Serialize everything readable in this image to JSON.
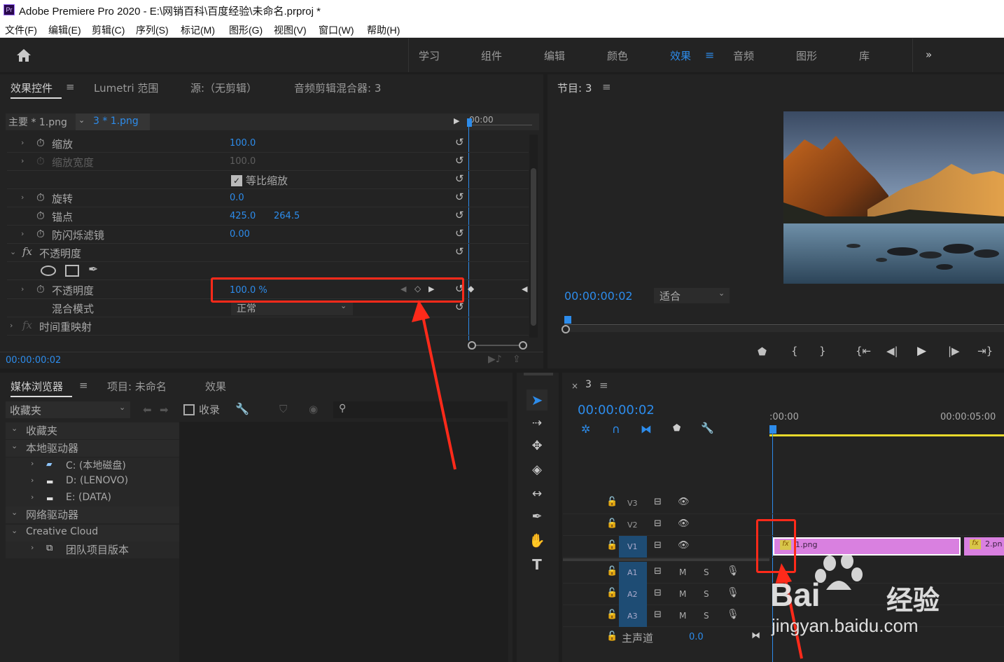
{
  "app": {
    "logo": "Pr",
    "title": "Adobe Premiere Pro 2020 - E:\\网销百科\\百度经验\\未命名.prproj *"
  },
  "menu": [
    "文件(F)",
    "编辑(E)",
    "剪辑(C)",
    "序列(S)",
    "标记(M)",
    "图形(G)",
    "视图(V)",
    "窗口(W)",
    "帮助(H)"
  ],
  "workspaces": [
    "学习",
    "组件",
    "编辑",
    "颜色",
    "效果",
    "音频",
    "图形",
    "库"
  ],
  "workspace_more": "»",
  "effect_controls": {
    "tabs": [
      "效果控件",
      "Lumetri 范围",
      "源:（无剪辑）",
      "音频剪辑混合器: 3"
    ],
    "master": "主要 * 1.png",
    "clip": "3 * 1.png",
    "timecode_ruler": "00:00",
    "rows": {
      "scale": "缩放",
      "scale_val": "100.0",
      "scale_width": "缩放宽度",
      "scale_width_val": "100.0",
      "uniform": "等比缩放",
      "rotation": "旋转",
      "rotation_val": "0.0",
      "anchor": "锚点",
      "anchor_x": "425.0",
      "anchor_y": "264.5",
      "flicker": "防闪烁滤镜",
      "flicker_val": "0.00",
      "opacity_group": "不透明度",
      "opacity": "不透明度",
      "opacity_val": "100.0 %",
      "blend": "混合模式",
      "blend_val": "正常",
      "time_remap": "时间重映射"
    },
    "fx": "fx",
    "footer_timecode": "00:00:00:02"
  },
  "program": {
    "title": "节目: 3",
    "timecode": "00:00:00:02",
    "fit": "适合"
  },
  "media": {
    "tabs": [
      "媒体浏览器",
      "项目: 未命名",
      "效果"
    ],
    "dropdown": "收藏夹",
    "ingest": "收录",
    "tree": [
      "收藏夹",
      "本地驱动器",
      "C: (本地磁盘)",
      "D: (LENOVO)",
      "E: (DATA)",
      "网络驱动器",
      "Creative Cloud",
      "团队项目版本"
    ]
  },
  "timeline": {
    "seq": "3",
    "timecode": "00:00:00:02",
    "ruler_start": ":00:00",
    "ruler_5": "00:00:05:00",
    "tracks": [
      "V3",
      "V2",
      "V1",
      "A1",
      "A2",
      "A3"
    ],
    "master": "主声道",
    "master_val": "0.0",
    "m": "M",
    "s": "S",
    "clip1": "1.png",
    "clip2": "2.pn",
    "fx": "fx"
  },
  "watermark": {
    "brand": "Bai",
    "brand2": "经验",
    "url": "jingyan.baidu.com"
  },
  "colors": {
    "accent": "#2d8ceb",
    "annotation": "#ff2a1a",
    "clip": "#d980e0",
    "panel": "#232323"
  }
}
